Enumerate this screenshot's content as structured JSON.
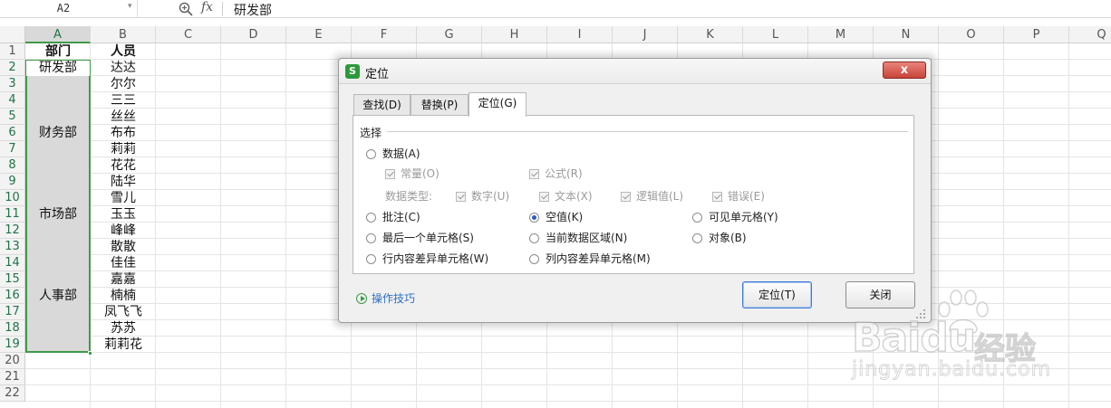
{
  "formula_bar": {
    "name_box": "A2",
    "fx_label": "fx",
    "value": "研发部"
  },
  "columns": [
    "A",
    "B",
    "C",
    "D",
    "E",
    "F",
    "G",
    "H",
    "I",
    "J",
    "K",
    "L",
    "M",
    "N",
    "O",
    "P",
    "Q"
  ],
  "rows": [
    "1",
    "2",
    "3",
    "4",
    "5",
    "6",
    "7",
    "8",
    "9",
    "10",
    "11",
    "12",
    "13",
    "14",
    "15",
    "16",
    "17",
    "18",
    "19",
    "20",
    "21",
    "22"
  ],
  "cells": {
    "A1": "部门",
    "B1": "人员",
    "A2": "研发部",
    "A6": "财务部",
    "A11": "市场部",
    "A16": "人事部",
    "B2": "达达",
    "B3": "尔尔",
    "B4": "三三",
    "B5": "丝丝",
    "B6": "布布",
    "B7": "莉莉",
    "B8": "花花",
    "B9": "陆华",
    "B10": "雪儿",
    "B11": "玉玉",
    "B12": "峰峰",
    "B13": "散散",
    "B14": "佳佳",
    "B15": "嘉嘉",
    "B16": "楠楠",
    "B17": "凤飞飞",
    "B18": "苏苏",
    "B19": "莉莉花"
  },
  "dialog": {
    "title": "定位",
    "close": "x",
    "tabs": [
      "查找(D)",
      "替换(P)",
      "定位(G)"
    ],
    "active_tab": "定位(G)",
    "group_label": "选择",
    "options": {
      "data": "数据(A)",
      "constant": "常量(O)",
      "formula": "公式(R)",
      "data_type_label": "数据类型:",
      "number": "数字(U)",
      "text": "文本(X)",
      "logical": "逻辑值(L)",
      "error": "错误(E)",
      "comment": "批注(C)",
      "blank": "空值(K)",
      "visible": "可见单元格(Y)",
      "last_cell": "最后一个单元格(S)",
      "current_region": "当前数据区域(N)",
      "object": "对象(B)",
      "row_diff": "行内容差异单元格(W)",
      "col_diff": "列内容差异单元格(M)"
    },
    "selected_option": "空值(K)",
    "tips": "操作技巧",
    "ok_button": "定位(T)",
    "close_button": "关闭"
  },
  "watermark": {
    "brand": "Bai",
    "brand2": "du",
    "product": "经验",
    "url": "jingyan.baidu.com"
  },
  "colors": {
    "selection_green": "#3f9a47",
    "selected_fill": "#d9d9d9",
    "link_blue": "#2d6fc5"
  }
}
